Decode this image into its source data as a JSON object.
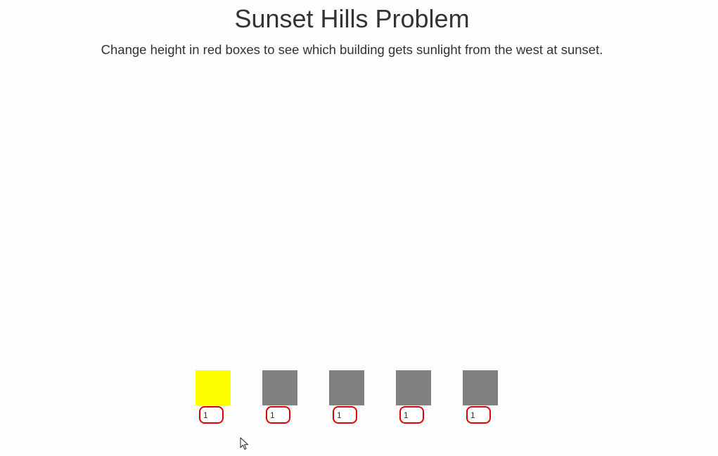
{
  "page": {
    "title": "Sunset Hills Problem",
    "instructions": "Change height in red boxes to see which building gets sunlight from the west at sunset."
  },
  "colors": {
    "sunlit": "#ffff00",
    "shaded": "#808080",
    "input_border": "#e00000"
  },
  "buildings": [
    {
      "height": "1",
      "sunlit": true
    },
    {
      "height": "1",
      "sunlit": false
    },
    {
      "height": "1",
      "sunlit": false
    },
    {
      "height": "1",
      "sunlit": false
    },
    {
      "height": "1",
      "sunlit": false
    }
  ]
}
